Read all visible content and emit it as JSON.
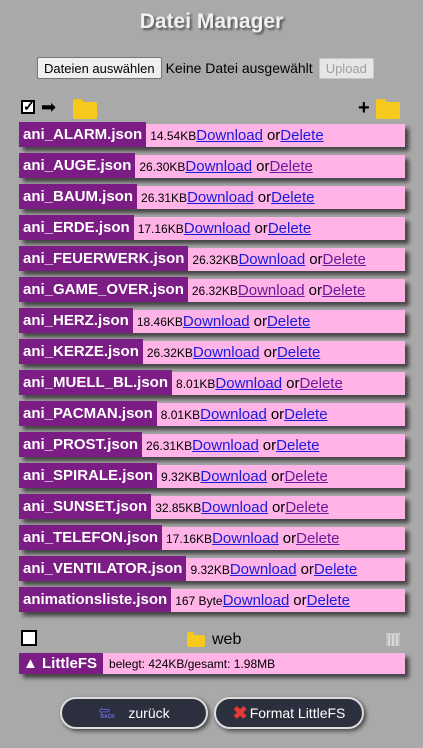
{
  "title": "Datei Manager",
  "upload": {
    "choose_label": "Dateien auswählen",
    "no_file_text": "Keine Datei ausgewählt",
    "upload_label": "Upload"
  },
  "files": [
    {
      "name": "ani_ALARM.json",
      "size": "14.54KB",
      "download": "Download",
      "or": "or",
      "delete": "Delete"
    },
    {
      "name": "ani_AUGE.json",
      "size": "26.30KB",
      "download": "Download",
      "or": "or",
      "delete": "Delete"
    },
    {
      "name": "ani_BAUM.json",
      "size": "26.31KB",
      "download": "Download",
      "or": "or",
      "delete": "Delete"
    },
    {
      "name": "ani_ERDE.json",
      "size": "17.16KB",
      "download": "Download",
      "or": "or",
      "delete": "Delete"
    },
    {
      "name": "ani_FEUERWERK.json",
      "size": "26.32KB",
      "download": "Download",
      "or": "or",
      "delete": "Delete"
    },
    {
      "name": "ani_GAME_OVER.json",
      "size": "26.32KB",
      "download": "Download",
      "or": "or",
      "delete": "Delete"
    },
    {
      "name": "ani_HERZ.json",
      "size": "18.46KB",
      "download": "Download",
      "or": "or",
      "delete": "Delete"
    },
    {
      "name": "ani_KERZE.json",
      "size": "26.32KB",
      "download": "Download",
      "or": "or",
      "delete": "Delete"
    },
    {
      "name": "ani_MUELL_BL.json",
      "size": "8.01KB",
      "download": "Download",
      "or": "or",
      "delete": "Delete"
    },
    {
      "name": "ani_PACMAN.json",
      "size": "8.01KB",
      "download": "Download",
      "or": "or",
      "delete": "Delete"
    },
    {
      "name": "ani_PROST.json",
      "size": "26.31KB",
      "download": "Download",
      "or": "or",
      "delete": "Delete"
    },
    {
      "name": "ani_SPIRALE.json",
      "size": "9.32KB",
      "download": "Download",
      "or": "or",
      "delete": "Delete"
    },
    {
      "name": "ani_SUNSET.json",
      "size": "32.85KB",
      "download": "Download",
      "or": "or",
      "delete": "Delete"
    },
    {
      "name": "ani_TELEFON.json",
      "size": "17.16KB",
      "download": "Download",
      "or": "or",
      "delete": "Delete"
    },
    {
      "name": "ani_VENTILATOR.json",
      "size": "9.32KB",
      "download": "Download",
      "or": "or",
      "delete": "Delete"
    },
    {
      "name": "animationsliste.json",
      "size": "167 Byte",
      "download": "Download",
      "or": "or",
      "delete": "Delete"
    }
  ],
  "folder_web": "web",
  "filesystem": {
    "name": "▲ LittleFS",
    "info": "belegt: 424KB/gesamt: 1.98MB"
  },
  "buttons": {
    "back_label": "zurück",
    "back_icon_text": "BACK",
    "format_label": "Format LittleFS"
  },
  "icons": {
    "checkbox_checked": true,
    "arrow": "➡",
    "plus": "+",
    "x": "✖"
  },
  "colors": {
    "background": "#a9a9a9",
    "row_bg": "#ffb3e6",
    "name_bg": "#7b1d84",
    "link": "#1b1bdb",
    "visited_link": "#6a1a9a",
    "folder": "#f7c91d",
    "button_bg": "#2c2f3e",
    "delete_x": "#e53935"
  },
  "visited_links": {
    "4_delete": true,
    "5_download": true,
    "5_delete": true,
    "8_delete": true,
    "11_delete": true,
    "12_delete": true,
    "13_delete": true,
    "1_delete": true
  }
}
